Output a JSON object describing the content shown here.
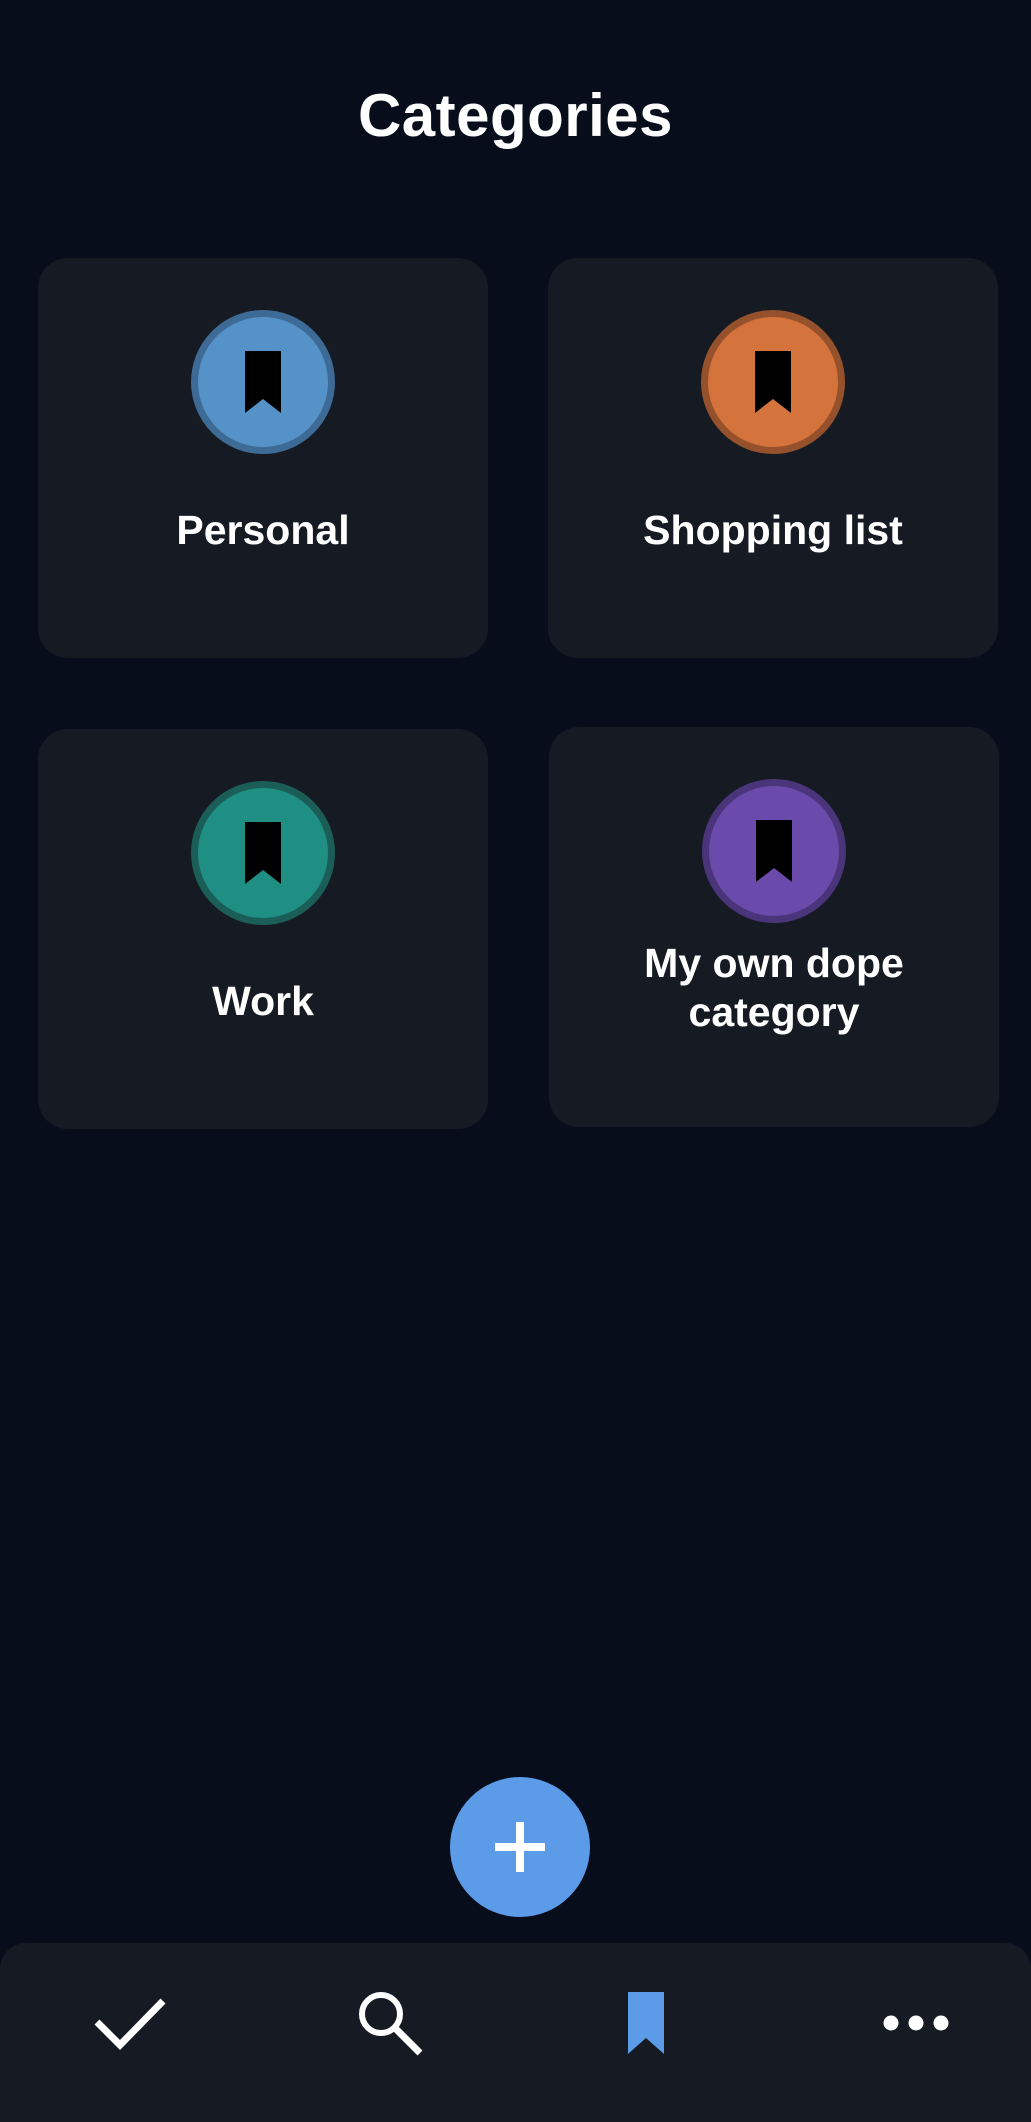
{
  "header": {
    "title": "Categories"
  },
  "categories": [
    {
      "label": "Personal",
      "color": "#5592c7",
      "border": "#3e6a96"
    },
    {
      "label": "Shopping list",
      "color": "#d5733d",
      "border": "#94512c"
    },
    {
      "label": "Work",
      "color": "#1f8f83",
      "border": "#1b5e57"
    },
    {
      "label": "My own dope category",
      "color": "#6a4aaa",
      "border": "#4a347a"
    }
  ],
  "fab": {
    "icon": "plus-icon",
    "color": "#5c9be8"
  },
  "bottom_nav": {
    "items": [
      {
        "icon": "checkmark-icon",
        "active": false
      },
      {
        "icon": "search-icon",
        "active": false
      },
      {
        "icon": "bookmark-icon",
        "active": true
      },
      {
        "icon": "more-horizontal-icon",
        "active": false
      }
    ],
    "active_color": "#5c9be8",
    "inactive_color": "#ffffff"
  }
}
